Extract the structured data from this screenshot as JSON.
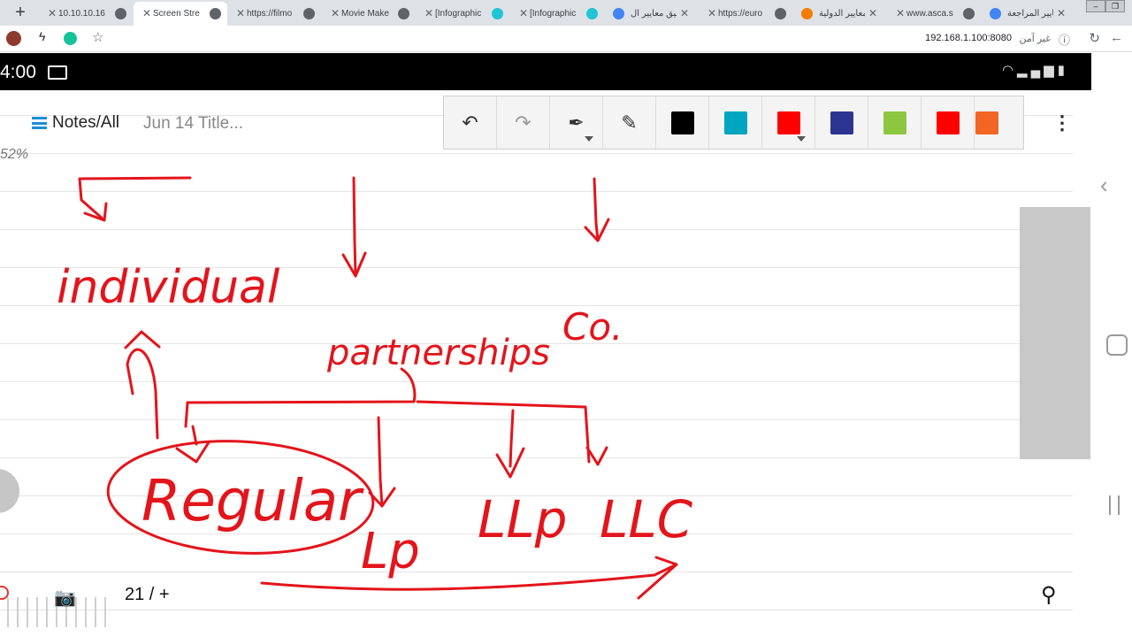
{
  "browser": {
    "tabs": [
      {
        "title": "10.10.10.16",
        "active": false,
        "rtl": false,
        "fav_color": "#5f6368"
      },
      {
        "title": "Screen Stre",
        "active": true,
        "rtl": false,
        "fav_color": "#5f6368"
      },
      {
        "title": "https://filmo",
        "active": false,
        "rtl": false,
        "fav_color": "#5f6368"
      },
      {
        "title": "Movie Make",
        "active": false,
        "rtl": false,
        "fav_color": "#5f6368"
      },
      {
        "title": "[Infographic",
        "active": false,
        "rtl": false,
        "fav_color": "#1fc5d4"
      },
      {
        "title": "[Infographic",
        "active": false,
        "rtl": false,
        "fav_color": "#1fc5d4"
      },
      {
        "title": "تطبيق معايير ال",
        "active": false,
        "rtl": true,
        "fav_color": "#4285f4"
      },
      {
        "title": "https://euro",
        "active": false,
        "rtl": false,
        "fav_color": "#5f6368"
      },
      {
        "title": "المعايير الدولية",
        "active": false,
        "rtl": true,
        "fav_color": "#f57c00"
      },
      {
        "title": "www.asca.s",
        "active": false,
        "rtl": false,
        "fav_color": "#5f6368"
      },
      {
        "title": "معايير المراجعة",
        "active": false,
        "rtl": true,
        "fav_color": "#4285f4"
      }
    ],
    "new_tab_glyph": "+",
    "url": "192.168.1.100:8080",
    "insecure_label": "غير آمن"
  },
  "statusbar": {
    "time": "4:00"
  },
  "notebook": {
    "title": "Notes/All",
    "page_title": "Jun 14 Title...",
    "zoom": "52%",
    "page_indicator": "21 / +"
  },
  "toolbar": {
    "colors": [
      "#000000",
      "#00a5c0",
      "#ff0000",
      "#2b3591",
      "#8dc63f",
      "#ff0000",
      "#f26522"
    ]
  },
  "handwriting": {
    "word_individual": "individual",
    "word_partnerships": "partnerships",
    "word_co": "Co.",
    "word_regular": "Regular",
    "word_lp": "Lp",
    "word_llp": "LLp",
    "word_llc": "LLC"
  },
  "ink_color": "#e4141b"
}
